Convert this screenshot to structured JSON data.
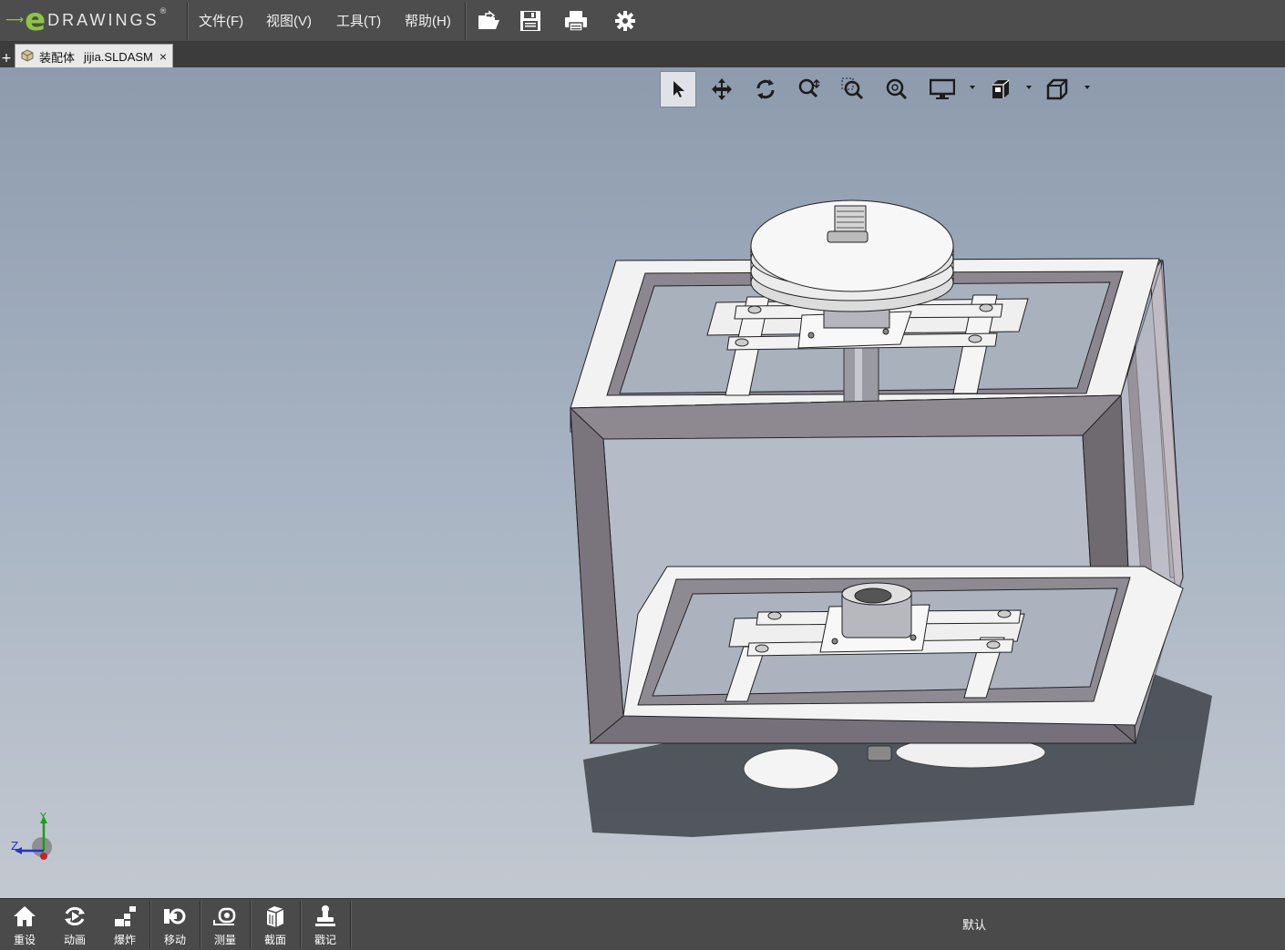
{
  "app": {
    "logo_e": "e",
    "logo_word": "DRAWINGS",
    "logo_reg": "®"
  },
  "menu": [
    {
      "label": "文件(F)"
    },
    {
      "label": "视图(V)"
    },
    {
      "label": "工具(T)"
    },
    {
      "label": "帮助(H)"
    }
  ],
  "toolbar": {
    "icons": [
      "open-icon",
      "save-icon",
      "print-icon",
      "settings-gear-icon"
    ]
  },
  "tab": {
    "plus": "+",
    "doc_type": "装配体",
    "filename": "jijia.SLDASM",
    "close": "×"
  },
  "hud": {
    "icons": [
      "select-icon",
      "pan-icon",
      "rotate-icon",
      "zoom-to-fit-icon",
      "zoom-to-area-icon",
      "zoom-icon",
      "display-style-icon",
      "view-orientation-icon",
      "standard-views-icon"
    ],
    "active": "select-icon"
  },
  "triad": {
    "y": "Y",
    "z": "Z"
  },
  "bottom": {
    "buttons": [
      {
        "label": "重设",
        "icon": "home-icon"
      },
      {
        "label": "动画",
        "icon": "animate-icon"
      },
      {
        "label": "爆炸",
        "icon": "explode-icon"
      },
      {
        "label": "移动",
        "icon": "move-icon"
      },
      {
        "label": "测量",
        "icon": "measure-icon"
      },
      {
        "label": "截面",
        "icon": "section-icon"
      },
      {
        "label": "戳记",
        "icon": "stamp-icon"
      }
    ],
    "configuration": "默认"
  }
}
